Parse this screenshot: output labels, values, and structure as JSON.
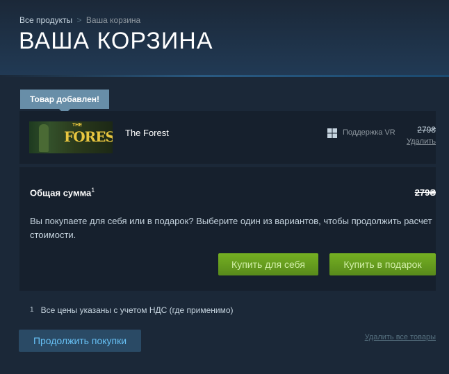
{
  "breadcrumb": {
    "root": "Все продукты",
    "separator": ">",
    "current": "Ваша корзина"
  },
  "page_title": "ВАША КОРЗИНА",
  "added_badge": "Товар добавлен!",
  "cart_item": {
    "name": "The Forest",
    "thumb_logo_small": "THE",
    "thumb_logo": "FOREST",
    "vr_support": "Поддержка VR",
    "price": "279₴",
    "remove_label": "Удалить"
  },
  "summary": {
    "total_label": "Общая сумма",
    "total_footnote_marker": "1",
    "total_price": "279₴",
    "choose_text": "Вы покупаете для себя или в подарок? Выберите один из вариантов, чтобы продолжить расчет стоимости.",
    "buy_self_label": "Купить для себя",
    "buy_gift_label": "Купить в подарок"
  },
  "footnote": {
    "number": "1",
    "text": "Все цены указаны с учетом НДС (где применимо)"
  },
  "continue_label": "Продолжить покупки",
  "remove_all_label": "Удалить все товары",
  "colors": {
    "background": "#1b2838",
    "panel": "#16202d",
    "badge": "#688ea8",
    "green_button": "#75b022",
    "link_blue": "#67c1f5"
  },
  "icons": [
    "windows-icon"
  ]
}
